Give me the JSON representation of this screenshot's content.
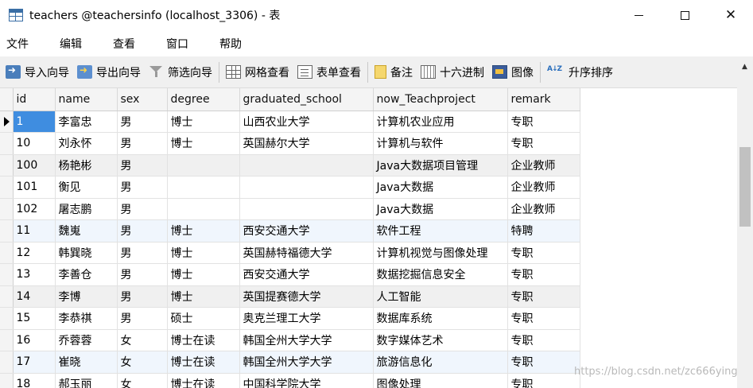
{
  "window": {
    "title": "teachers @teachersinfo (localhost_3306) - 表",
    "controls": {
      "minimize": "",
      "maximize": "",
      "close": "✕"
    }
  },
  "menu": [
    "文件",
    "编辑",
    "查看",
    "窗口",
    "帮助"
  ],
  "toolbar": {
    "import_wizard": "导入向导",
    "export_wizard": "导出向导",
    "filter_wizard": "筛选向导",
    "grid_view": "网格查看",
    "form_view": "表单查看",
    "memo": "备注",
    "hex": "十六进制",
    "image": "图像",
    "sort_asc": "升序排序"
  },
  "table": {
    "columns": [
      "id",
      "name",
      "sex",
      "degree",
      "graduated_school",
      "now_Teachproject",
      "remark"
    ],
    "rows": [
      [
        "1",
        "李富忠",
        "男",
        "博士",
        "山西农业大学",
        "计算机农业应用",
        "专职"
      ],
      [
        "10",
        "刘永怀",
        "男",
        "博士",
        "英国赫尔大学",
        "计算机与软件",
        "专职"
      ],
      [
        "100",
        "杨艳彬",
        "男",
        "",
        "",
        "Java大数据项目管理",
        "企业教师"
      ],
      [
        "101",
        "衡见",
        "男",
        "",
        "",
        "Java大数据",
        "企业教师"
      ],
      [
        "102",
        "屠志鹏",
        "男",
        "",
        "",
        "Java大数据",
        "企业教师"
      ],
      [
        "11",
        "魏嵬",
        "男",
        "博士",
        "西安交通大学",
        "软件工程",
        "特聘"
      ],
      [
        "12",
        "韩巽晓",
        "男",
        "博士",
        "英国赫特福德大学",
        "计算机视觉与图像处理",
        "专职"
      ],
      [
        "13",
        "李善仓",
        "男",
        "博士",
        "西安交通大学",
        "数据挖掘信息安全",
        "专职"
      ],
      [
        "14",
        "李博",
        "男",
        "博士",
        "英国提赛德大学",
        "人工智能",
        "专职"
      ],
      [
        "15",
        "李恭祺",
        "男",
        "硕士",
        "奥克兰理工大学",
        "数据库系统",
        "专职"
      ],
      [
        "16",
        "乔蓉蓉",
        "女",
        "博士在读",
        "韩国全州大学大学",
        "数字媒体艺术",
        "专职"
      ],
      [
        "17",
        "崔晓",
        "女",
        "博士在读",
        "韩国全州大学大学",
        "旅游信息化",
        "专职"
      ],
      [
        "18",
        "郝玉丽",
        "女",
        "博士在读",
        "中国科学院大学",
        "图像处理",
        "专职"
      ]
    ]
  },
  "watermark": "https://blog.csdn.net/zc666ying"
}
